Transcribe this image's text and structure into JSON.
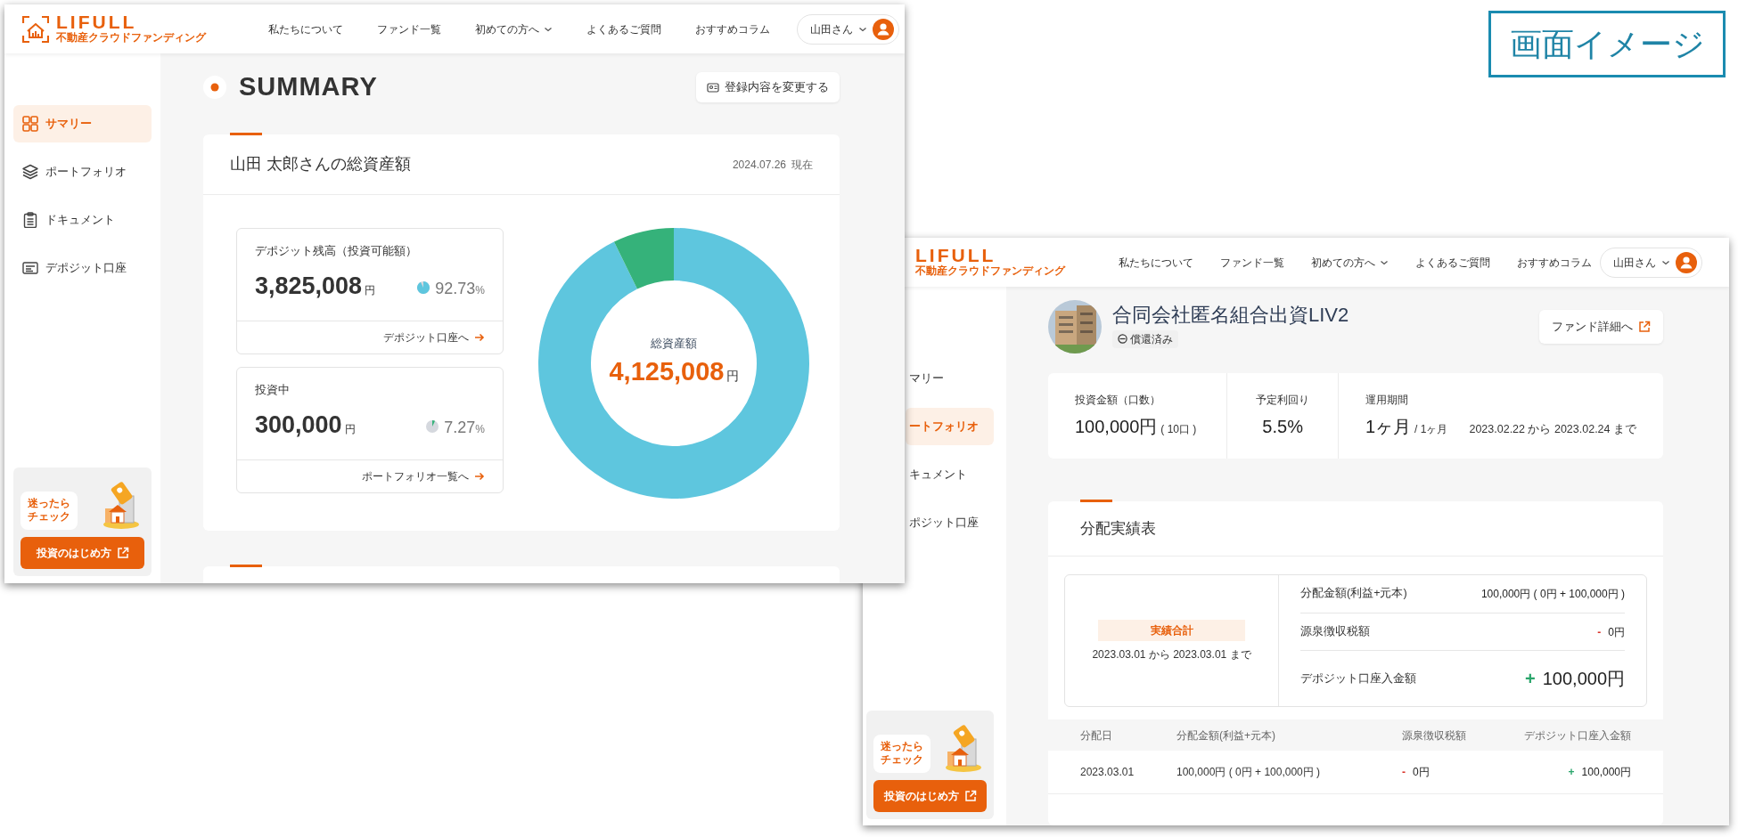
{
  "image_label": "画面イメージ",
  "summary_screen": {
    "logo": {
      "name": "LIFULL",
      "tagline": "不動産クラウドファンディング"
    },
    "nav": [
      {
        "label": "私たちについて",
        "dropdown": false
      },
      {
        "label": "ファンド一覧",
        "dropdown": false
      },
      {
        "label": "初めての方へ",
        "dropdown": true
      },
      {
        "label": "よくあるご質問",
        "dropdown": false
      },
      {
        "label": "おすすめコラム",
        "dropdown": false
      }
    ],
    "user": "山田さん",
    "sidebar": [
      {
        "label": "サマリー",
        "selected": true
      },
      {
        "label": "ポートフォリオ",
        "selected": false
      },
      {
        "label": "ドキュメント",
        "selected": false
      },
      {
        "label": "デポジット口座",
        "selected": false
      }
    ],
    "help_banner": {
      "bubble": [
        "迷ったら",
        "チェック"
      ],
      "button": "投資のはじめ方"
    },
    "page_title": "SUMMARY",
    "edit_button": "登録内容を変更する",
    "assets_card": {
      "title": "山田 太郎さんの総資産額",
      "date": "2024.07.26",
      "date_suffix": "現在",
      "items": [
        {
          "label": "デポジット残高（投資可能額）",
          "amount": "3,825,008",
          "unit": "円",
          "percent": "92.73",
          "percent_unit": "%",
          "color": "#5ec6de",
          "link": "デポジット口座へ"
        },
        {
          "label": "投資中",
          "amount": "300,000",
          "unit": "円",
          "percent": "7.27",
          "percent_unit": "%",
          "color": "#35b27a",
          "link": "ポートフォリオ一覧へ"
        }
      ],
      "total": {
        "label": "総資産額",
        "amount": "4,125,008",
        "unit": "円"
      },
      "chart_data": {
        "type": "donut",
        "values": [
          92.73,
          7.27
        ]
      }
    }
  },
  "fund_screen": {
    "logo": {
      "name": "LIFULL",
      "tagline": "不動産クラウドファンディング"
    },
    "nav": [
      {
        "label": "私たちについて",
        "dropdown": false
      },
      {
        "label": "ファンド一覧",
        "dropdown": false
      },
      {
        "label": "初めての方へ",
        "dropdown": true
      },
      {
        "label": "よくあるご質問",
        "dropdown": false
      },
      {
        "label": "おすすめコラム",
        "dropdown": false
      }
    ],
    "user": "山田さん",
    "sidebar": [
      {
        "label": "マリー",
        "selected": false
      },
      {
        "label": "ートフォリオ",
        "selected": true
      },
      {
        "label": "キュメント",
        "selected": false
      },
      {
        "label": "ポジット口座",
        "selected": false
      }
    ],
    "help_banner": {
      "bubble": [
        "迷ったら",
        "チェック"
      ],
      "button": "投資のはじめ方"
    },
    "fund": {
      "name": "合同会社匿名組合出資LIV2",
      "status": "償還済み",
      "detail_button": "ファンド詳細へ"
    },
    "stats": [
      {
        "label": "投資金額（口数）",
        "value": "100,000円",
        "sub": "( 10口 )"
      },
      {
        "label": "予定利回り",
        "value": "5.5%"
      },
      {
        "label": "運用期間",
        "value": "1ヶ月",
        "sub": "/ 1ヶ月",
        "range": "2023.02.22 から 2023.02.24 まで"
      }
    ],
    "distribution": {
      "title": "分配実績表",
      "summary": {
        "badge": "実績合計",
        "period": "2023.03.01 から 2023.03.01 まで",
        "rows": [
          {
            "label": "分配金額(利益+元本)",
            "value": "100,000円 ( 0円 + 100,000円 )",
            "emphasis": false
          },
          {
            "label": "源泉徴収税額",
            "sign": "-",
            "positive": false,
            "value": "0円",
            "emphasis": false
          },
          {
            "label": "デポジット口座入金額",
            "sign": "+",
            "positive": true,
            "value": "100,000円",
            "emphasis": true
          }
        ]
      },
      "table": {
        "columns": [
          "分配日",
          "分配金額(利益+元本)",
          "源泉徴収税額",
          "デポジット口座入金額"
        ],
        "rows": [
          {
            "date": "2023.03.01",
            "amount": "100,000円 ( 0円 + 100,000円 )",
            "tax": {
              "sign": "-",
              "positive": false,
              "value": "0円"
            },
            "deposit": {
              "sign": "+",
              "positive": true,
              "value": "100,000円"
            }
          }
        ]
      }
    }
  }
}
